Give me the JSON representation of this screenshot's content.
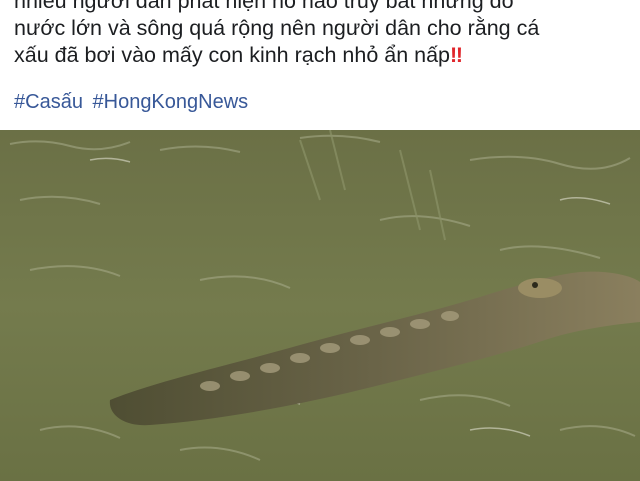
{
  "post": {
    "text_lines": [
      "nhiều người dân phát hiện hô hào truy bắt nhưng do",
      "nước lớn và sông quá rộng nên người dân cho rằng cá",
      "xấu đã bơi vào mấy con kinh rạch nhỏ ẩn nấp"
    ],
    "emoji": "‼"
  },
  "hashtags": [
    "#Casấu",
    "#HongKongNews"
  ],
  "photo": {
    "icon": "crocodile-in-river-photo",
    "water_color": "#6e7548"
  }
}
